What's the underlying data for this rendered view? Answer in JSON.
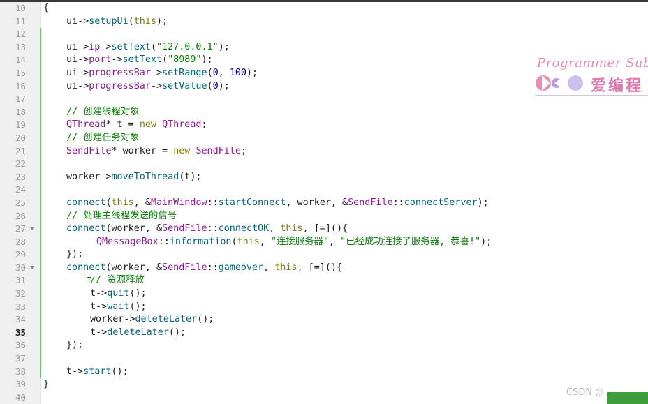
{
  "window": {
    "title": ""
  },
  "editor": {
    "current_line": 35,
    "lines": [
      {
        "n": "10",
        "indent": 0,
        "modified": false,
        "fold": false,
        "tokens": [
          [
            "id",
            "{"
          ]
        ]
      },
      {
        "n": "11",
        "indent": 1,
        "modified": false,
        "fold": false,
        "tokens": [
          [
            "id",
            "ui->"
          ],
          [
            "fn",
            "setupUi"
          ],
          [
            "id",
            "("
          ],
          [
            "kw",
            "this"
          ],
          [
            "id",
            ");"
          ]
        ]
      },
      {
        "n": "12",
        "indent": 0,
        "modified": true,
        "fold": false,
        "tokens": []
      },
      {
        "n": "13",
        "indent": 1,
        "modified": true,
        "fold": false,
        "tokens": [
          [
            "id",
            "ui->"
          ],
          [
            "typ",
            "ip"
          ],
          [
            "id",
            "->"
          ],
          [
            "fn",
            "setText"
          ],
          [
            "id",
            "("
          ],
          [
            "str",
            "\"127.0.0.1\""
          ],
          [
            "id",
            ");"
          ]
        ]
      },
      {
        "n": "14",
        "indent": 1,
        "modified": true,
        "fold": false,
        "tokens": [
          [
            "id",
            "ui->"
          ],
          [
            "typ",
            "port"
          ],
          [
            "id",
            "->"
          ],
          [
            "fn",
            "setText"
          ],
          [
            "id",
            "("
          ],
          [
            "str",
            "\"8989\""
          ],
          [
            "id",
            ");"
          ]
        ]
      },
      {
        "n": "15",
        "indent": 1,
        "modified": true,
        "fold": false,
        "tokens": [
          [
            "id",
            "ui->"
          ],
          [
            "typ",
            "progressBar"
          ],
          [
            "id",
            "->"
          ],
          [
            "fn",
            "setRange"
          ],
          [
            "id",
            "("
          ],
          [
            "num",
            "0"
          ],
          [
            "id",
            ", "
          ],
          [
            "num",
            "100"
          ],
          [
            "id",
            ");"
          ]
        ]
      },
      {
        "n": "16",
        "indent": 1,
        "modified": true,
        "fold": false,
        "tokens": [
          [
            "id",
            "ui->"
          ],
          [
            "typ",
            "progressBar"
          ],
          [
            "id",
            "->"
          ],
          [
            "fn",
            "setValue"
          ],
          [
            "id",
            "("
          ],
          [
            "num",
            "0"
          ],
          [
            "id",
            ");"
          ]
        ]
      },
      {
        "n": "17",
        "indent": 0,
        "modified": true,
        "fold": false,
        "tokens": []
      },
      {
        "n": "18",
        "indent": 1,
        "modified": true,
        "fold": false,
        "tokens": [
          [
            "cmt",
            "// 创建线程对象"
          ]
        ]
      },
      {
        "n": "19",
        "indent": 1,
        "modified": true,
        "fold": false,
        "tokens": [
          [
            "typ",
            "QThread"
          ],
          [
            "id",
            "* t = "
          ],
          [
            "kw",
            "new"
          ],
          [
            "id",
            " "
          ],
          [
            "typ",
            "QThread"
          ],
          [
            "id",
            ";"
          ]
        ]
      },
      {
        "n": "20",
        "indent": 1,
        "modified": true,
        "fold": false,
        "tokens": [
          [
            "cmt",
            "// 创建任务对象"
          ]
        ]
      },
      {
        "n": "21",
        "indent": 1,
        "modified": true,
        "fold": false,
        "tokens": [
          [
            "typ",
            "SendFile"
          ],
          [
            "id",
            "* worker = "
          ],
          [
            "kw",
            "new"
          ],
          [
            "id",
            " "
          ],
          [
            "typ",
            "SendFile"
          ],
          [
            "id",
            ";"
          ]
        ]
      },
      {
        "n": "22",
        "indent": 0,
        "modified": true,
        "fold": false,
        "tokens": []
      },
      {
        "n": "23",
        "indent": 1,
        "modified": true,
        "fold": false,
        "tokens": [
          [
            "id",
            "worker->"
          ],
          [
            "fn",
            "moveToThread"
          ],
          [
            "id",
            "(t);"
          ]
        ]
      },
      {
        "n": "24",
        "indent": 0,
        "modified": true,
        "fold": false,
        "tokens": []
      },
      {
        "n": "25",
        "indent": 1,
        "modified": true,
        "fold": false,
        "tokens": [
          [
            "fn",
            "connect"
          ],
          [
            "id",
            "("
          ],
          [
            "kw",
            "this"
          ],
          [
            "id",
            ", &"
          ],
          [
            "typ",
            "MainWindow"
          ],
          [
            "id",
            "::"
          ],
          [
            "fn",
            "startConnect"
          ],
          [
            "id",
            ", worker, &"
          ],
          [
            "typ",
            "SendFile"
          ],
          [
            "id",
            "::"
          ],
          [
            "fn",
            "connectServer"
          ],
          [
            "id",
            ");"
          ]
        ]
      },
      {
        "n": "26",
        "indent": 1,
        "modified": true,
        "fold": false,
        "tokens": [
          [
            "cmt",
            "// 处理主线程发送的信号"
          ]
        ]
      },
      {
        "n": "27",
        "indent": 1,
        "modified": true,
        "fold": true,
        "tokens": [
          [
            "fn",
            "connect"
          ],
          [
            "id",
            "(worker, &"
          ],
          [
            "typ",
            "SendFile"
          ],
          [
            "id",
            "::"
          ],
          [
            "fn",
            "connectOK"
          ],
          [
            "id",
            ", "
          ],
          [
            "kw",
            "this"
          ],
          [
            "id",
            ", [=](){"
          ]
        ]
      },
      {
        "n": "28",
        "indent": 3,
        "modified": true,
        "fold": false,
        "tokens": [
          [
            "typ",
            "QMessageBox"
          ],
          [
            "id",
            "::"
          ],
          [
            "fn",
            "information"
          ],
          [
            "id",
            "("
          ],
          [
            "kw",
            "this"
          ],
          [
            "id",
            ", "
          ],
          [
            "str",
            "\"连接服务器\""
          ],
          [
            "id",
            ", "
          ],
          [
            "str",
            "\"已经成功连接了服务器, 恭喜!\""
          ],
          [
            "id",
            ");"
          ]
        ]
      },
      {
        "n": "29",
        "indent": 1,
        "modified": true,
        "fold": false,
        "tokens": [
          [
            "id",
            "});"
          ]
        ]
      },
      {
        "n": "30",
        "indent": 1,
        "modified": true,
        "fold": true,
        "tokens": [
          [
            "fn",
            "connect"
          ],
          [
            "id",
            "(worker, &"
          ],
          [
            "typ",
            "SendFile"
          ],
          [
            "id",
            "::"
          ],
          [
            "fn",
            "gameover"
          ],
          [
            "id",
            ", "
          ],
          [
            "kw",
            "this"
          ],
          [
            "id",
            ", [=](){"
          ]
        ]
      },
      {
        "n": "31",
        "indent": 2,
        "modified": true,
        "fold": false,
        "tokens": [
          [
            "cmt",
            "// 资源释放"
          ]
        ]
      },
      {
        "n": "32",
        "indent": 2,
        "modified": true,
        "fold": false,
        "tokens": [
          [
            "id",
            "t->"
          ],
          [
            "fn",
            "quit"
          ],
          [
            "id",
            "();"
          ]
        ]
      },
      {
        "n": "33",
        "indent": 2,
        "modified": true,
        "fold": false,
        "tokens": [
          [
            "id",
            "t->"
          ],
          [
            "fn",
            "wait"
          ],
          [
            "id",
            "();"
          ]
        ]
      },
      {
        "n": "34",
        "indent": 2,
        "modified": true,
        "fold": false,
        "tokens": [
          [
            "id",
            "worker->"
          ],
          [
            "fn",
            "deleteLater"
          ],
          [
            "id",
            "();"
          ]
        ]
      },
      {
        "n": "35",
        "indent": 2,
        "modified": true,
        "fold": false,
        "tokens": [
          [
            "id",
            "t->"
          ],
          [
            "fn",
            "deleteLater"
          ],
          [
            "id",
            "();"
          ]
        ]
      },
      {
        "n": "36",
        "indent": 1,
        "modified": true,
        "fold": false,
        "tokens": [
          [
            "id",
            "});"
          ]
        ]
      },
      {
        "n": "37",
        "indent": 0,
        "modified": true,
        "fold": false,
        "tokens": []
      },
      {
        "n": "38",
        "indent": 1,
        "modified": true,
        "fold": false,
        "tokens": [
          [
            "id",
            "t->"
          ],
          [
            "fn",
            "start"
          ],
          [
            "id",
            "();"
          ]
        ]
      },
      {
        "n": "39",
        "indent": 0,
        "modified": false,
        "fold": false,
        "tokens": [
          [
            "id",
            "}"
          ]
        ]
      },
      {
        "n": "40",
        "indent": 0,
        "modified": false,
        "fold": false,
        "tokens": []
      }
    ]
  },
  "watermark": {
    "title": "Programmer Subin",
    "chinese": "爱编程",
    "colors": {
      "pink": "#e98ab8",
      "purple": "#b49ce0",
      "lilac": "#cdbfee"
    }
  },
  "footer": {
    "credit": "CSDN @"
  },
  "colors": {
    "comment": "#108010",
    "string": "#0b7a0b",
    "keyword": "#7f7f00",
    "type": "#8c1c8c",
    "function": "#00677c",
    "number": "#000080",
    "modified_marker": "#6dbf6d"
  }
}
